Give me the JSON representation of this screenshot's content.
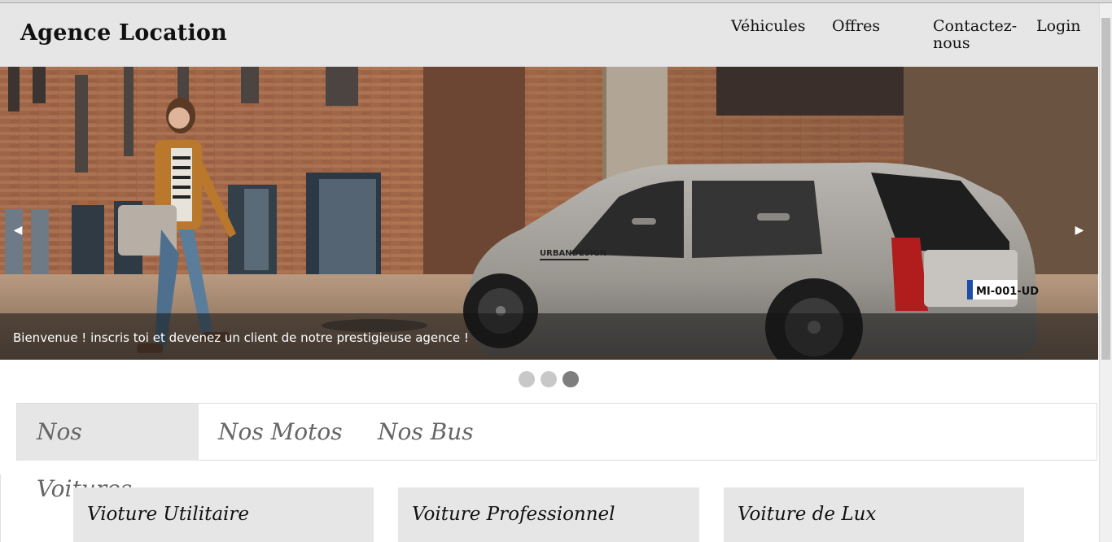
{
  "header": {
    "brand": "Agence Location",
    "nav": {
      "vehicules": "Véhicules",
      "offres": "Offres",
      "contact": "Contactez-nous",
      "login": "Login"
    }
  },
  "carousel": {
    "caption": "Bienvenue ! inscris toi et devenez un client de notre prestigieuse agence !",
    "prev_icon": "◀",
    "next_icon": "▶",
    "active_slide": 3,
    "slide_count": 3,
    "plate": "MI-001-UD",
    "door_badge": "URBANDESIGN"
  },
  "tabs": {
    "items": [
      "Nos Voitures",
      "Nos Motos",
      "Nos Bus"
    ],
    "active": "Nos Voitures"
  },
  "cards": [
    {
      "title": "Vioture Utilitaire"
    },
    {
      "title": "Voiture Professionnel"
    },
    {
      "title": "Voiture de Lux"
    }
  ],
  "colors": {
    "header_bg": "#e6e6e6",
    "active_dot": "#7e7e7e",
    "inactive_dot": "#c8c8c8"
  }
}
